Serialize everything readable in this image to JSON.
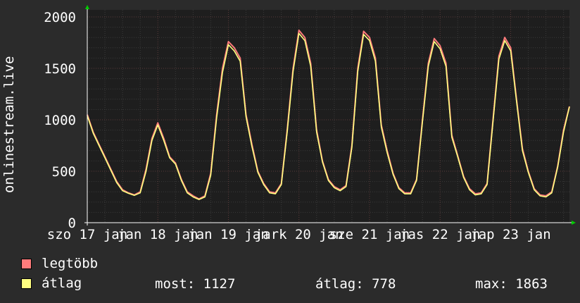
{
  "chart_data": {
    "type": "line",
    "ylabel": "onlinestream.live",
    "ylim": [
      0,
      2000
    ],
    "yticks": [
      0,
      500,
      1000,
      1500,
      2000
    ],
    "xlim": [
      0,
      164
    ],
    "xtick_positions": [
      0,
      24,
      48,
      72,
      96,
      120,
      144
    ],
    "xtick_labels": [
      "szo 17 jan",
      "jan 18 jan",
      "jan 19 jan",
      "jark 20 jan",
      "sze 21 jan",
      "jas 22 jan",
      "jap 23 jan"
    ],
    "grid": true,
    "series": [
      {
        "name": "legtöbb",
        "color": "#ff7b7b",
        "x": [
          0,
          2,
          4,
          6,
          8,
          10,
          12,
          14,
          16,
          18,
          20,
          22,
          24,
          26,
          28,
          30,
          32,
          34,
          36,
          38,
          40,
          42,
          44,
          46,
          48,
          50,
          52,
          54,
          56,
          58,
          60,
          62,
          64,
          66,
          68,
          70,
          72,
          74,
          76,
          78,
          80,
          82,
          84,
          86,
          88,
          90,
          92,
          94,
          96,
          98,
          100,
          102,
          104,
          106,
          108,
          110,
          112,
          114,
          116,
          118,
          120,
          122,
          124,
          126,
          128,
          130,
          132,
          134,
          136,
          138,
          140,
          142,
          144,
          146,
          148,
          150,
          152,
          154,
          156,
          158,
          160,
          162,
          164
        ],
        "values": [
          1050,
          880,
          760,
          640,
          520,
          400,
          320,
          290,
          270,
          300,
          520,
          820,
          970,
          820,
          640,
          580,
          420,
          300,
          260,
          230,
          260,
          480,
          1050,
          1500,
          1760,
          1700,
          1600,
          1050,
          760,
          500,
          380,
          300,
          290,
          380,
          900,
          1500,
          1870,
          1800,
          1550,
          900,
          600,
          420,
          350,
          320,
          360,
          750,
          1500,
          1860,
          1800,
          1600,
          950,
          700,
          480,
          340,
          290,
          290,
          420,
          1000,
          1550,
          1790,
          1720,
          1550,
          850,
          650,
          450,
          330,
          280,
          290,
          380,
          1000,
          1620,
          1800,
          1700,
          1200,
          720,
          500,
          330,
          270,
          260,
          300,
          550,
          900,
          1130
        ]
      },
      {
        "name": "átlag",
        "color": "#ffff80",
        "x": [
          0,
          2,
          4,
          6,
          8,
          10,
          12,
          14,
          16,
          18,
          20,
          22,
          24,
          26,
          28,
          30,
          32,
          34,
          36,
          38,
          40,
          42,
          44,
          46,
          48,
          50,
          52,
          54,
          56,
          58,
          60,
          62,
          64,
          66,
          68,
          70,
          72,
          74,
          76,
          78,
          80,
          82,
          84,
          86,
          88,
          90,
          92,
          94,
          96,
          98,
          100,
          102,
          104,
          106,
          108,
          110,
          112,
          114,
          116,
          118,
          120,
          122,
          124,
          126,
          128,
          130,
          132,
          134,
          136,
          138,
          140,
          142,
          144,
          146,
          148,
          150,
          152,
          154,
          156,
          158,
          160,
          162,
          164
        ],
        "values": [
          1040,
          870,
          750,
          630,
          510,
          390,
          310,
          285,
          265,
          290,
          500,
          800,
          950,
          800,
          630,
          570,
          410,
          290,
          250,
          225,
          250,
          460,
          1020,
          1460,
          1730,
          1670,
          1570,
          1030,
          740,
          490,
          370,
          290,
          280,
          370,
          880,
          1470,
          1840,
          1770,
          1520,
          880,
          590,
          410,
          340,
          310,
          350,
          730,
          1470,
          1830,
          1770,
          1570,
          930,
          680,
          470,
          330,
          280,
          280,
          410,
          980,
          1520,
          1760,
          1690,
          1520,
          830,
          640,
          440,
          320,
          270,
          280,
          370,
          980,
          1590,
          1770,
          1670,
          1180,
          700,
          490,
          320,
          260,
          250,
          290,
          540,
          880,
          1127
        ]
      }
    ]
  },
  "legend": [
    {
      "label": "legtöbb",
      "color": "#ff7b7b"
    },
    {
      "label": "átlag",
      "color": "#ffff80"
    }
  ],
  "stats": {
    "most": "most: 1127",
    "atlag": "átlag: 778",
    "max": "max: 1863"
  }
}
